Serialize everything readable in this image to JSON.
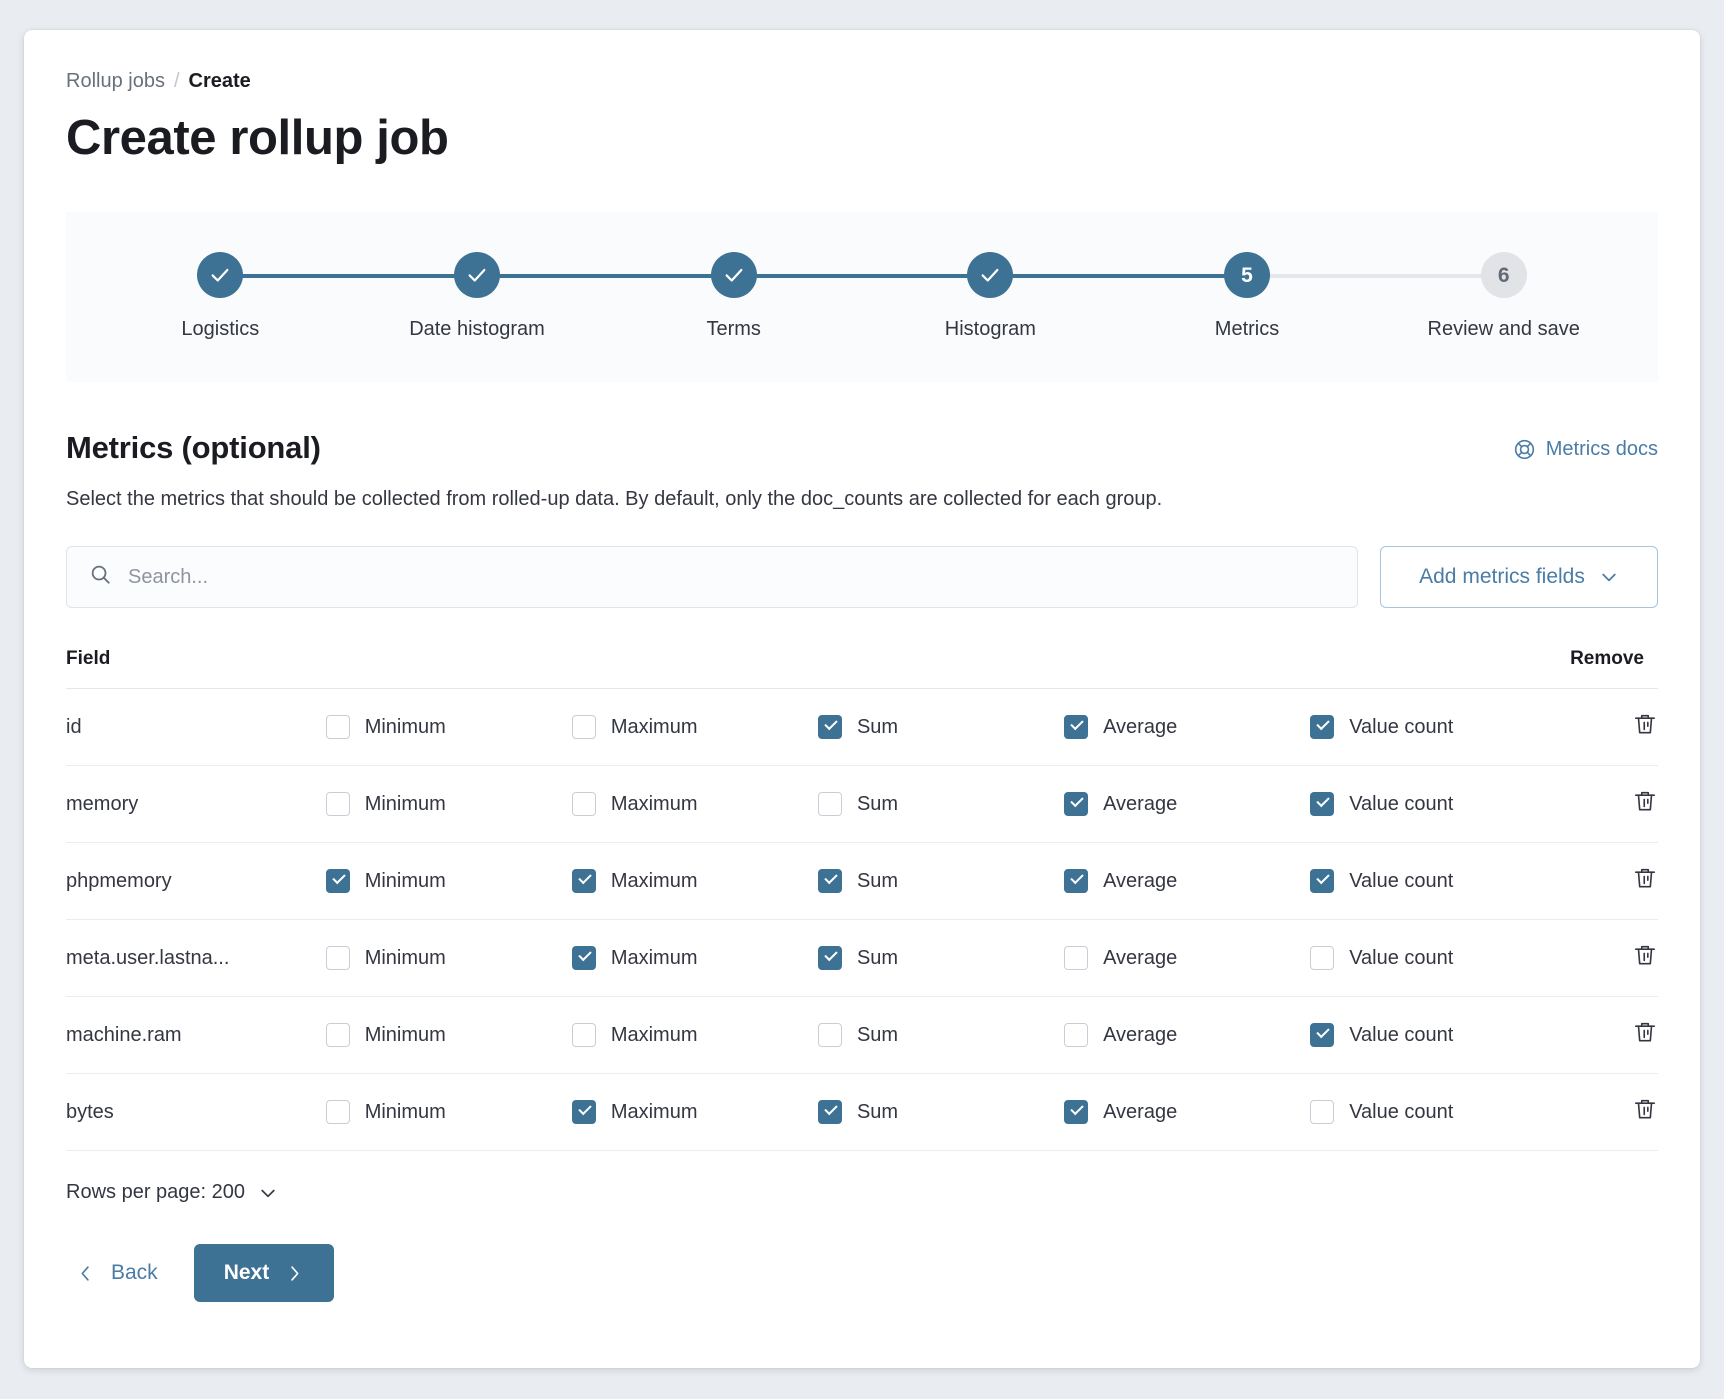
{
  "breadcrumb": {
    "parent": "Rollup jobs",
    "separator": "/",
    "current": "Create"
  },
  "page_title": "Create rollup job",
  "stepper": {
    "steps": [
      {
        "label": "Logistics",
        "number": "1",
        "state": "done",
        "glyph": "check"
      },
      {
        "label": "Date histogram",
        "number": "2",
        "state": "done",
        "glyph": "check"
      },
      {
        "label": "Terms",
        "number": "3",
        "state": "done",
        "glyph": "check"
      },
      {
        "label": "Histogram",
        "number": "4",
        "state": "done",
        "glyph": "check"
      },
      {
        "label": "Metrics",
        "number": "5",
        "state": "current",
        "glyph": "number"
      },
      {
        "label": "Review and save",
        "number": "6",
        "state": "pending",
        "glyph": "number"
      }
    ],
    "colors": {
      "active": "#3d7294",
      "pending_bg": "#e1e3e6",
      "pending_text": "#646a75"
    }
  },
  "section": {
    "title": "Metrics (optional)",
    "docs_link_label": "Metrics docs",
    "docs_icon": "help-ring-icon",
    "description": "Select the metrics that should be collected from rolled-up data. By default, only the doc_counts are collected for each group."
  },
  "search": {
    "icon": "search-icon",
    "placeholder": "Search...",
    "value": ""
  },
  "add_fields_button": {
    "label": "Add metrics fields",
    "icon": "chevron-down-icon"
  },
  "table": {
    "headers": {
      "field": "Field",
      "remove": "Remove"
    },
    "metric_labels": [
      "Minimum",
      "Maximum",
      "Sum",
      "Average",
      "Value count"
    ],
    "remove_icon": "trash-icon",
    "rows": [
      {
        "field": "id",
        "checks": [
          false,
          false,
          true,
          true,
          true
        ]
      },
      {
        "field": "memory",
        "checks": [
          false,
          false,
          false,
          true,
          true
        ]
      },
      {
        "field": "phpmemory",
        "checks": [
          true,
          true,
          true,
          true,
          true
        ]
      },
      {
        "field": "meta.user.lastna...",
        "checks": [
          false,
          true,
          true,
          false,
          false
        ]
      },
      {
        "field": "machine.ram",
        "checks": [
          false,
          false,
          false,
          false,
          true
        ]
      },
      {
        "field": "bytes",
        "checks": [
          false,
          true,
          true,
          true,
          false
        ]
      }
    ]
  },
  "pagination": {
    "rows_per_page_label": "Rows per page: 200",
    "icon": "chevron-down-icon"
  },
  "footer": {
    "back_label": "Back",
    "back_icon": "chevron-left-icon",
    "next_label": "Next",
    "next_icon": "chevron-right-icon"
  },
  "colors": {
    "accent": "#3d7294",
    "link": "#4a7ca6",
    "text": "#343741",
    "heading": "#1a1c21",
    "muted": "#69707d",
    "panel_bg": "#fafbfd"
  }
}
